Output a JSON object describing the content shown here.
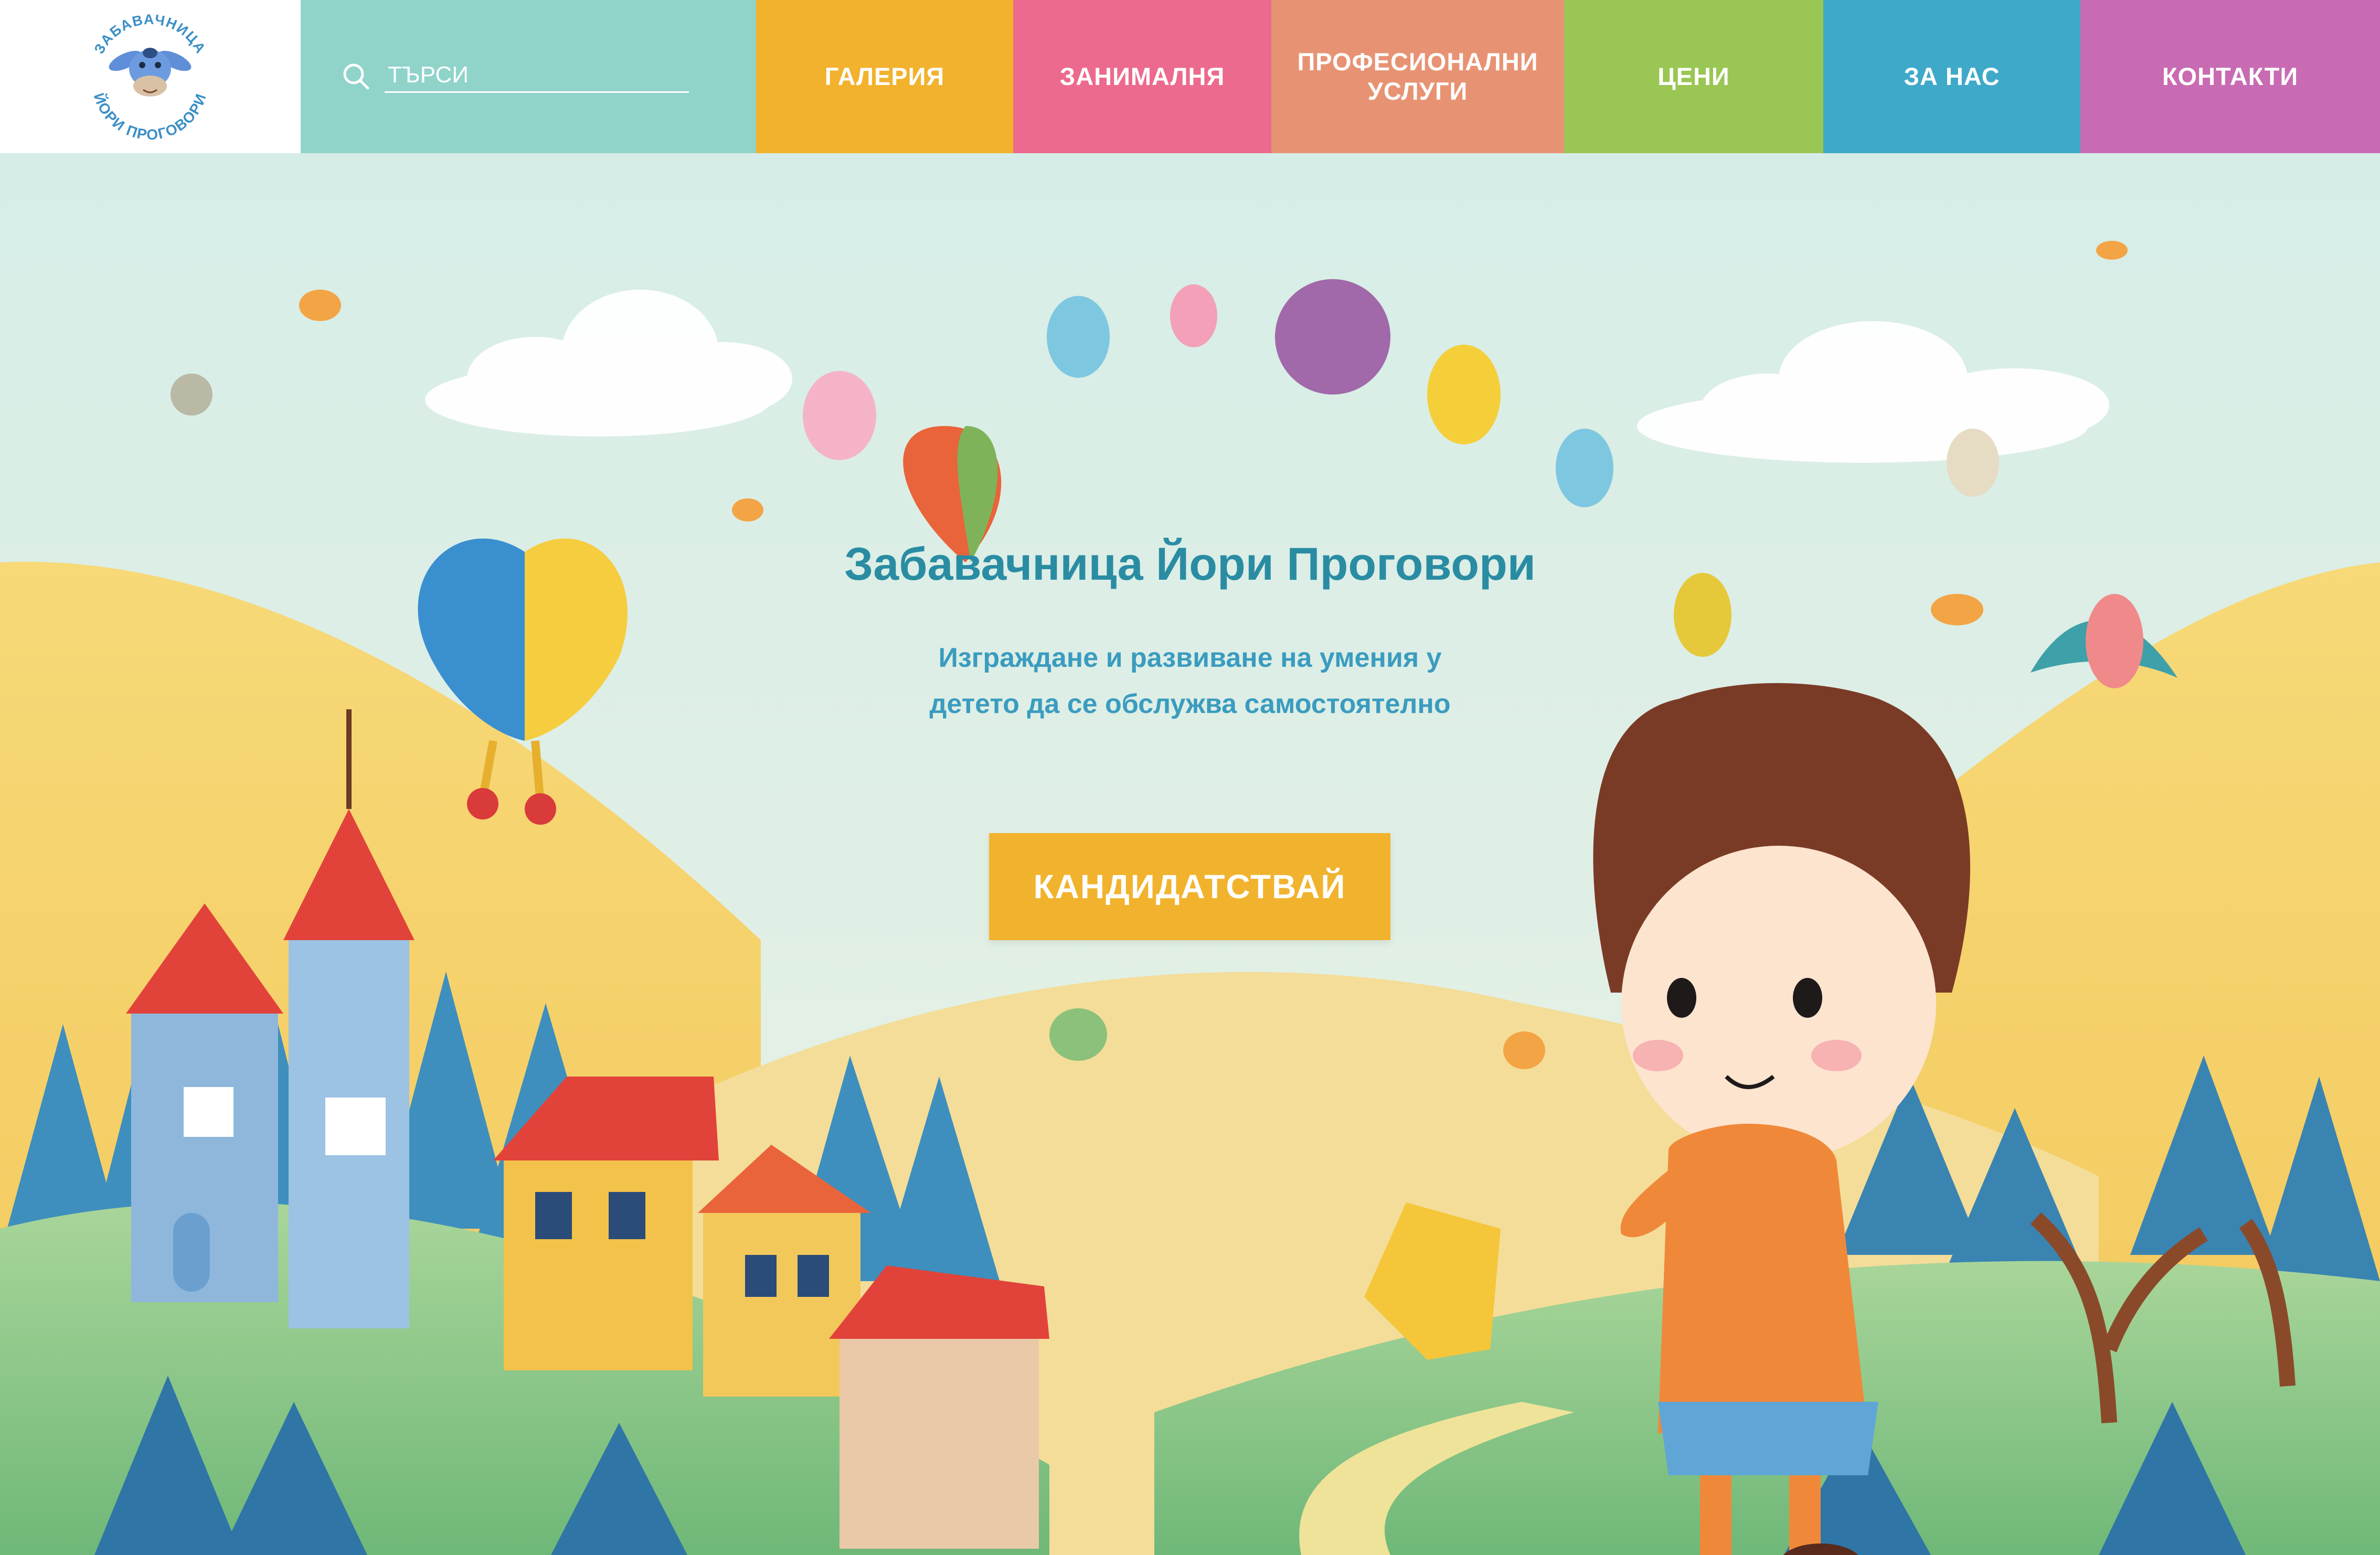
{
  "logo": {
    "text_top": "ЗАБАВАЧНИЦА",
    "text_bottom": "ЙОРИ ПРОГОВОРИ"
  },
  "search": {
    "placeholder": "ТЪРСИ"
  },
  "nav": [
    {
      "label": "ГАЛЕРИЯ",
      "color": "#f2b22d"
    },
    {
      "label": "ЗАНИМАЛНЯ",
      "color": "#ec6a8d"
    },
    {
      "label": "ПРОФЕСИОНАЛНИ\nУСЛУГИ",
      "color": "#e79373"
    },
    {
      "label": "ЦЕНИ",
      "color": "#9ac653"
    },
    {
      "label": "ЗА НАС",
      "color": "#3ea9c8"
    },
    {
      "label": "КОНТАКТИ",
      "color": "#c86bb3"
    }
  ],
  "hero": {
    "title": "Забавачница Йори Проговори",
    "subtitle": "Изграждане и развиване на умения у детето да се обслужва самостоятелно",
    "cta_label": "КАНДИДАТСТВАЙ"
  },
  "colors": {
    "title": "#2a8ca3",
    "subtitle": "#3a9cbf",
    "cta": "#f1b32e",
    "sky": "#dcefe9",
    "search_bar": "#8fd3c9"
  }
}
